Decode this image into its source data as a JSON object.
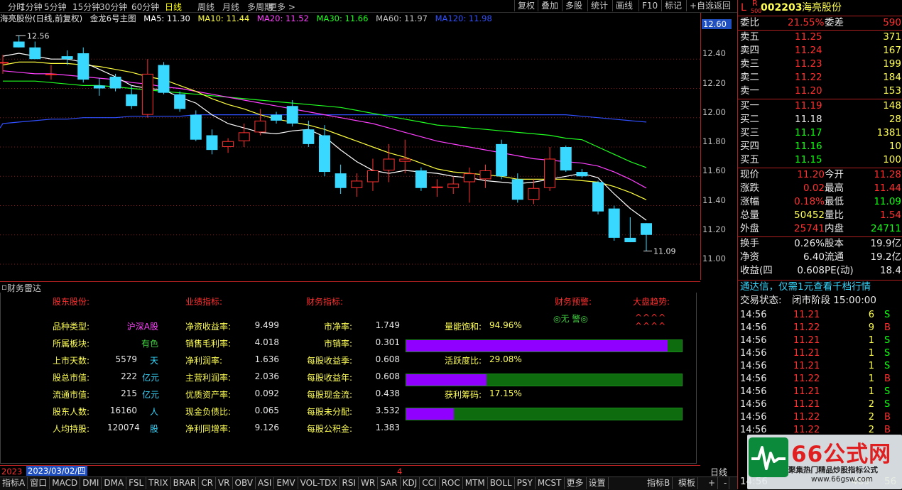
{
  "toolbar": {
    "periods": [
      "分时",
      "1分钟",
      "5分钟",
      "15分钟",
      "30分钟",
      "60分钟",
      "日线",
      "周线",
      "月线",
      "多周期",
      "更多 >"
    ],
    "active_period": "日线",
    "buttons": [
      "复权",
      "叠加",
      "多股",
      "统计",
      "画线",
      "F10",
      "标记",
      "+自选",
      "返回"
    ]
  },
  "chart_header": {
    "title": "海亮股份(日线,前复权)",
    "indicator": "金龙6号主图",
    "ma5": "MA5: 11.30",
    "ma10": "MA10: 11.44",
    "ma20": "MA20: 11.52",
    "ma30": "MA30: 11.66",
    "ma60": "MA60: 11.97",
    "ma120": "MA120: 11.98"
  },
  "colors": {
    "up": "#ff3030",
    "down": "#38d8ff",
    "ma5": "#ffffff",
    "ma10": "#ffff40",
    "ma20": "#ff40ff",
    "ma30": "#20ff20",
    "ma60": "#3050ff",
    "ma120": "#3050ff"
  },
  "y_axis": {
    "current_price": "12.60",
    "ticks": [
      "12.40",
      "12.20",
      "12.00",
      "11.80",
      "11.60",
      "11.40",
      "11.20",
      "11.00"
    ],
    "high_label": "12.56",
    "low_label": "11.09"
  },
  "chart_data": {
    "type": "candlestick",
    "ylim": [
      11.0,
      12.6
    ],
    "candles": [
      {
        "o": 12.38,
        "h": 12.43,
        "l": 12.3,
        "c": 12.38
      },
      {
        "o": 12.52,
        "h": 12.56,
        "l": 12.48,
        "c": 12.48
      },
      {
        "o": 12.48,
        "h": 12.52,
        "l": 12.4,
        "c": 12.4
      },
      {
        "o": 12.3,
        "h": 12.36,
        "l": 12.26,
        "c": 12.3
      },
      {
        "o": 12.42,
        "h": 12.46,
        "l": 12.36,
        "c": 12.4
      },
      {
        "o": 12.44,
        "h": 12.48,
        "l": 12.24,
        "c": 12.26
      },
      {
        "o": 12.22,
        "h": 12.27,
        "l": 12.15,
        "c": 12.2
      },
      {
        "o": 12.28,
        "h": 12.3,
        "l": 12.18,
        "c": 12.2
      },
      {
        "o": 12.16,
        "h": 12.22,
        "l": 12.06,
        "c": 12.08
      },
      {
        "o": 12.02,
        "h": 12.4,
        "l": 12.0,
        "c": 12.3
      },
      {
        "o": 12.36,
        "h": 12.38,
        "l": 12.16,
        "c": 12.17
      },
      {
        "o": 12.16,
        "h": 12.18,
        "l": 12.04,
        "c": 12.06
      },
      {
        "o": 12.02,
        "h": 12.05,
        "l": 11.84,
        "c": 11.85
      },
      {
        "o": 11.88,
        "h": 11.92,
        "l": 11.75,
        "c": 11.78
      },
      {
        "o": 11.8,
        "h": 11.86,
        "l": 11.76,
        "c": 11.84
      },
      {
        "o": 11.84,
        "h": 11.96,
        "l": 11.8,
        "c": 11.9
      },
      {
        "o": 11.9,
        "h": 12.06,
        "l": 11.88,
        "c": 11.98
      },
      {
        "o": 12.02,
        "h": 12.04,
        "l": 11.96,
        "c": 11.98
      },
      {
        "o": 12.08,
        "h": 12.12,
        "l": 11.94,
        "c": 11.96
      },
      {
        "o": 11.92,
        "h": 11.98,
        "l": 11.8,
        "c": 11.82
      },
      {
        "o": 11.88,
        "h": 11.95,
        "l": 11.6,
        "c": 11.63
      },
      {
        "o": 11.62,
        "h": 11.68,
        "l": 11.48,
        "c": 11.52
      },
      {
        "o": 11.52,
        "h": 11.62,
        "l": 11.46,
        "c": 11.57
      },
      {
        "o": 11.56,
        "h": 11.72,
        "l": 11.5,
        "c": 11.64
      },
      {
        "o": 11.64,
        "h": 11.82,
        "l": 11.56,
        "c": 11.72
      },
      {
        "o": 11.7,
        "h": 11.85,
        "l": 11.62,
        "c": 11.72
      },
      {
        "o": 11.64,
        "h": 11.66,
        "l": 11.5,
        "c": 11.52
      },
      {
        "o": 11.52,
        "h": 11.58,
        "l": 11.46,
        "c": 11.53
      },
      {
        "o": 11.52,
        "h": 11.6,
        "l": 11.48,
        "c": 11.55
      },
      {
        "o": 11.56,
        "h": 11.66,
        "l": 11.42,
        "c": 11.62
      },
      {
        "o": 11.58,
        "h": 11.68,
        "l": 11.52,
        "c": 11.64
      },
      {
        "o": 11.82,
        "h": 11.85,
        "l": 11.58,
        "c": 11.6
      },
      {
        "o": 11.58,
        "h": 11.62,
        "l": 11.42,
        "c": 11.44
      },
      {
        "o": 11.44,
        "h": 11.58,
        "l": 11.41,
        "c": 11.52
      },
      {
        "o": 11.52,
        "h": 11.8,
        "l": 11.5,
        "c": 11.72
      },
      {
        "o": 11.8,
        "h": 11.81,
        "l": 11.63,
        "c": 11.64
      },
      {
        "o": 11.63,
        "h": 11.65,
        "l": 11.59,
        "c": 11.6
      },
      {
        "o": 11.56,
        "h": 11.57,
        "l": 11.34,
        "c": 11.36
      },
      {
        "o": 11.38,
        "h": 11.4,
        "l": 11.16,
        "c": 11.18
      },
      {
        "o": 11.18,
        "h": 11.32,
        "l": 11.15,
        "c": 11.15
      },
      {
        "o": 11.28,
        "h": 11.28,
        "l": 11.09,
        "c": 11.2
      }
    ],
    "ma5": [
      12.42,
      12.44,
      12.42,
      12.4,
      12.4,
      12.38,
      12.33,
      12.28,
      12.22,
      12.2,
      12.19,
      12.14,
      12.1,
      12.02,
      11.96,
      11.93,
      11.9,
      11.89,
      11.91,
      11.92,
      11.87,
      11.78,
      11.7,
      11.64,
      11.62,
      11.64,
      11.63,
      11.62,
      11.6,
      11.59,
      11.57,
      11.56,
      11.55,
      11.56,
      11.58,
      11.6,
      11.62,
      11.59,
      11.48,
      11.38,
      11.3
    ],
    "ma10": [
      12.36,
      12.38,
      12.38,
      12.37,
      12.37,
      12.36,
      12.35,
      12.33,
      12.31,
      12.28,
      12.26,
      12.22,
      12.18,
      12.13,
      12.09,
      12.06,
      12.02,
      11.99,
      11.97,
      11.95,
      11.92,
      11.88,
      11.84,
      11.8,
      11.76,
      11.73,
      11.69,
      11.65,
      11.63,
      11.62,
      11.61,
      11.6,
      11.58,
      11.58,
      11.58,
      11.58,
      11.57,
      11.56,
      11.53,
      11.49,
      11.44
    ],
    "ma20": [
      12.32,
      12.31,
      12.3,
      12.3,
      12.29,
      12.28,
      12.27,
      12.26,
      12.24,
      12.23,
      12.21,
      12.2,
      12.18,
      12.16,
      12.14,
      12.12,
      12.1,
      12.08,
      12.06,
      12.04,
      12.02,
      12.0,
      11.98,
      11.96,
      11.93,
      11.9,
      11.87,
      11.84,
      11.82,
      11.8,
      11.78,
      11.76,
      11.74,
      11.72,
      11.71,
      11.7,
      11.69,
      11.67,
      11.63,
      11.58,
      11.52
    ],
    "ma30": [
      12.25,
      12.25,
      12.25,
      12.24,
      12.23,
      12.22,
      12.22,
      12.21,
      12.2,
      12.19,
      12.18,
      12.17,
      12.16,
      12.15,
      12.14,
      12.13,
      12.12,
      12.11,
      12.1,
      12.09,
      12.08,
      12.07,
      12.05,
      12.03,
      12.01,
      11.99,
      11.97,
      11.95,
      11.94,
      11.93,
      11.92,
      11.91,
      11.9,
      11.89,
      11.88,
      11.86,
      11.85,
      11.8,
      11.75,
      11.7,
      11.66
    ],
    "ma60": [
      11.96,
      11.97,
      11.98,
      11.99,
      11.99,
      12.0,
      12.0,
      12.0,
      12.01,
      12.01,
      12.01,
      12.01,
      12.02,
      12.02,
      12.02,
      12.02,
      12.02,
      12.02,
      12.02,
      12.02,
      12.02,
      12.02,
      12.02,
      12.02,
      12.02,
      12.02,
      12.02,
      12.02,
      12.02,
      12.02,
      12.02,
      12.02,
      12.02,
      12.02,
      12.02,
      12.02,
      12.01,
      12.0,
      11.99,
      11.98,
      11.97
    ]
  },
  "radar": {
    "title": "财务雷达",
    "sections": {
      "holders": "股东股份:",
      "performance": "业绩指标:",
      "finance": "财务指标:",
      "warning": "财务预警:",
      "trend": "大盘趋势:"
    },
    "col1": [
      {
        "label": "品种类型:",
        "value": "沪深A股",
        "unit": ""
      },
      {
        "label": "所属板块:",
        "value": "有色",
        "unit": ""
      },
      {
        "label": "上市天数:",
        "value": "5579",
        "unit": "天"
      },
      {
        "label": "股总市值:",
        "value": "222",
        "unit": "亿元"
      },
      {
        "label": "流通市值:",
        "value": "215",
        "unit": "亿元"
      },
      {
        "label": "股东人数:",
        "value": "16160",
        "unit": "人"
      },
      {
        "label": "人均持股:",
        "value": "120074",
        "unit": "股"
      }
    ],
    "col2": [
      {
        "label": "净资收益率:",
        "value": "9.499"
      },
      {
        "label": "销售毛利率:",
        "value": "4.018"
      },
      {
        "label": "净利润率:",
        "value": "1.636"
      },
      {
        "label": "主营利润率:",
        "value": "2.036"
      },
      {
        "label": "优质资产率:",
        "value": "0.092"
      },
      {
        "label": "现金负债比:",
        "value": "0.065"
      },
      {
        "label": "净利同增率:",
        "value": "9.126"
      }
    ],
    "col3": [
      {
        "label": "市净率:",
        "value": "1.749"
      },
      {
        "label": "市销率:",
        "value": "0.301"
      },
      {
        "label": "每股收益季:",
        "value": "0.608"
      },
      {
        "label": "每股收益年:",
        "value": "0.608"
      },
      {
        "label": "每股现金流:",
        "value": "0.438"
      },
      {
        "label": "每股未分配:",
        "value": "3.532"
      },
      {
        "label": "每股公积金:",
        "value": "1.383"
      }
    ],
    "warning_value": "◎无 警◎",
    "trend_value_1": "^^^^",
    "trend_value_2": "^^^^",
    "meters": [
      {
        "label": "量能饱和:",
        "value": "94.96%",
        "fraction": 0.9496
      },
      {
        "label": "活跃度比:",
        "value": "29.08%",
        "fraction": 0.2908
      },
      {
        "label": "获利筹码:",
        "value": "17.15%",
        "fraction": 0.1715
      }
    ]
  },
  "date_strip": {
    "prefix": "2023",
    "date": "2023/03/02/四",
    "marker": "4"
  },
  "bottom_tabs": [
    "指标A",
    "窗口",
    "MACD",
    "DMI",
    "DMA",
    "FSL",
    "TRIX",
    "BRAR",
    "CR",
    "VR",
    "OBV",
    "ASI",
    "EMV",
    "VOL-TDX",
    "RSI",
    "WR",
    "SAR",
    "KDJ",
    "CCI",
    "ROC",
    "MTM",
    "BOLL",
    "PSY",
    "MCST",
    "更多",
    "设置"
  ],
  "bottom_right": {
    "idx_b": "指标B",
    "template": "模板",
    "plus": "+",
    "minus": "-",
    "period": "日线"
  },
  "quote": {
    "code": "002203",
    "name": "海亮股份",
    "flag_l": "L",
    "flag_r": "R",
    "flag_sub": "500",
    "weibi_label": "委比",
    "weibi": "21.55%",
    "weicha_label": "委差",
    "weicha": "590",
    "asks": [
      {
        "label": "卖五",
        "price": "11.25",
        "vol": "371"
      },
      {
        "label": "卖四",
        "price": "11.24",
        "vol": "167"
      },
      {
        "label": "卖三",
        "price": "11.23",
        "vol": "199"
      },
      {
        "label": "卖二",
        "price": "11.22",
        "vol": "184"
      },
      {
        "label": "卖一",
        "price": "11.20",
        "vol": "153"
      }
    ],
    "bids": [
      {
        "label": "买一",
        "price": "11.19",
        "vol": "148"
      },
      {
        "label": "买二",
        "price": "11.18",
        "vol": "28"
      },
      {
        "label": "买三",
        "price": "11.17",
        "vol": "1381"
      },
      {
        "label": "买四",
        "price": "11.16",
        "vol": "10"
      },
      {
        "label": "买五",
        "price": "11.15",
        "vol": "100"
      }
    ],
    "stats": [
      {
        "l1": "现价",
        "v1": "11.20",
        "l2": "今开",
        "v2": "11.28"
      },
      {
        "l1": "涨跌",
        "v1": "0.02",
        "l2": "最高",
        "v2": "11.44"
      },
      {
        "l1": "涨幅",
        "v1": "0.18%",
        "l2": "最低",
        "v2": "11.09"
      },
      {
        "l1": "总量",
        "v1": "50452",
        "l2": "量比",
        "v2": "1.54"
      },
      {
        "l1": "外盘",
        "v1": "25741",
        "l2": "内盘",
        "v2": "24711"
      }
    ],
    "fund": [
      {
        "l1": "换手",
        "v1": "0.26%",
        "l2": "股本",
        "v2": "19.9亿"
      },
      {
        "l1": "净资",
        "v1": "6.40",
        "l2": "流通",
        "v2": "19.2亿"
      },
      {
        "l1": "收益(四",
        "v1": "0.608",
        "l2": "PE(动)",
        "v2": "18.4"
      }
    ],
    "promo": "通达信，仅需1元查看千档行情",
    "status_label": "交易状态:",
    "status": "闭市阶段 15:00:00",
    "ticks": [
      {
        "t": "14:56",
        "p": "11.21",
        "v": "6",
        "s": "S"
      },
      {
        "t": "14:56",
        "p": "11.22",
        "v": "9",
        "s": "B"
      },
      {
        "t": "14:56",
        "p": "11.21",
        "v": "1",
        "s": "S"
      },
      {
        "t": "14:56",
        "p": "11.21",
        "v": "1",
        "s": "S"
      },
      {
        "t": "14:56",
        "p": "11.21",
        "v": "1",
        "s": "S"
      },
      {
        "t": "14:56",
        "p": "11.22",
        "v": "1",
        "s": "B"
      },
      {
        "t": "14:56",
        "p": "11.21",
        "v": "1",
        "s": "S"
      },
      {
        "t": "14:56",
        "p": "11.21",
        "v": "2",
        "s": "S"
      },
      {
        "t": "14:56",
        "p": "11.22",
        "v": "2",
        "s": "B"
      },
      {
        "t": "14:56",
        "p": "11.22",
        "v": "2",
        "s": "B"
      }
    ],
    "tail": [
      "14:56",
      "469",
      "56"
    ]
  },
  "watermark": {
    "brand": "66公式网",
    "tagline": "聚集热门精品炒股指标公式",
    "url": "www.66gsw.com"
  }
}
